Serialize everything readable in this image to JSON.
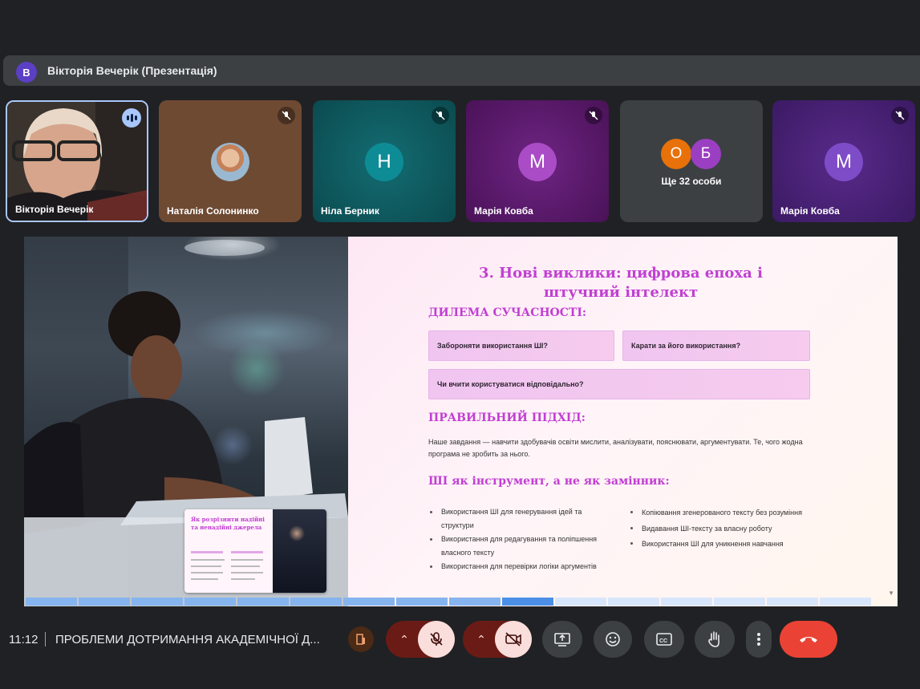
{
  "presenter": {
    "avatar_letter": "В",
    "title": "Вікторія Вечерік (Презентація)"
  },
  "participants": [
    {
      "name": "Вікторія Вечерік",
      "type": "video",
      "speaking": true
    },
    {
      "name": "Наталія Солонинко",
      "type": "photo",
      "muted": true,
      "color": "#6e4a33"
    },
    {
      "name": "Ніла Берник",
      "type": "letter",
      "letter": "Н",
      "muted": true,
      "color": "#0f5d61",
      "avatar_color": "#0e8c95"
    },
    {
      "name": "Марія Ковба",
      "type": "letter",
      "letter": "М",
      "muted": true,
      "color": "#5e1c70",
      "avatar_color": "#a94cc6"
    },
    {
      "name": "Ще 32 особи",
      "type": "more",
      "letters": [
        "О",
        "Б"
      ],
      "letter_colors": [
        "#e8710a",
        "#9b3fc2"
      ]
    },
    {
      "name": "Марія Ковба",
      "type": "letter",
      "letter": "М",
      "muted": true,
      "color": "#4a1f7c",
      "avatar_color": "#7f4cc8"
    }
  ],
  "slide": {
    "title": "3. Нові виклики: цифрова епоха і штучний інтелект",
    "dilemma_heading": "ДИЛЕМА СУЧАСНОСТІ:",
    "questions": [
      "Забороняти використання ШІ?",
      "Карати за його використання?",
      "Чи вчити користуватися відповідально?"
    ],
    "approach_heading": "ПРАВИЛЬНИЙ ПІДХІД:",
    "approach_text": "Наше завдання — навчити здобувачів освіти мислити, аналізувати, пояснювати, аргументувати. Те, чого жодна програма не зробить за нього.",
    "tool_heading": "ШІ як інструмент, а не як замінник:",
    "good_uses": [
      "Використання ШІ для генерування ідей та структури",
      "Використання для редагування та поліпшення власного тексту",
      "Використання для перевірки логіки аргументів"
    ],
    "bad_uses": [
      "Копіювання згенерованого тексту без розуміння",
      "Видавання ШІ-тексту за власну роботу",
      "Використання ШІ для уникнення навчання"
    ],
    "thumbnail_title": "Як розрізнити надійні та ненадійні джерела",
    "progress": {
      "completed": 9,
      "current": 10,
      "total": 16
    }
  },
  "bottom": {
    "time": "11:12",
    "meeting_title": "ПРОБЛЕМИ ДОТРИМАННЯ АКАДЕМІЧНОЇ Д..."
  },
  "colors": {
    "accent": "#c13fd3",
    "end_call": "#ea4335",
    "muted_red": "#f9dedc"
  }
}
